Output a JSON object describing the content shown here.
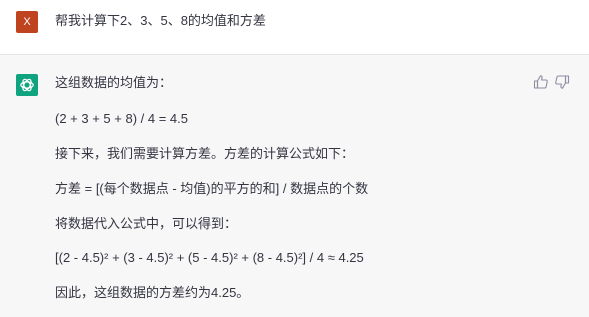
{
  "user_message": {
    "avatar_text": "X",
    "text": "帮我计算下2、3、5、8的均值和方差"
  },
  "assistant_message": {
    "paragraphs": [
      "这组数据的均值为：",
      "(2 + 3 + 5 + 8) / 4 = 4.5",
      "接下来，我们需要计算方差。方差的计算公式如下：",
      "方差 = [(每个数据点 - 均值)的平方的和] / 数据点的个数",
      "将数据代入公式中，可以得到：",
      "[(2 - 4.5)² + (3 - 4.5)² + (5 - 4.5)² + (8 - 4.5)²] / 4 ≈ 4.25",
      "因此，这组数据的方差约为4.25。"
    ],
    "icons": {
      "avatar": "openai-logo-icon",
      "feedback_up": "thumbs-up-icon",
      "feedback_down": "thumbs-down-icon"
    }
  },
  "colors": {
    "user_avatar": "#c0431f",
    "assistant_avatar": "#10a37f",
    "assistant_background": "#f7f7f8",
    "text": "#343541"
  }
}
